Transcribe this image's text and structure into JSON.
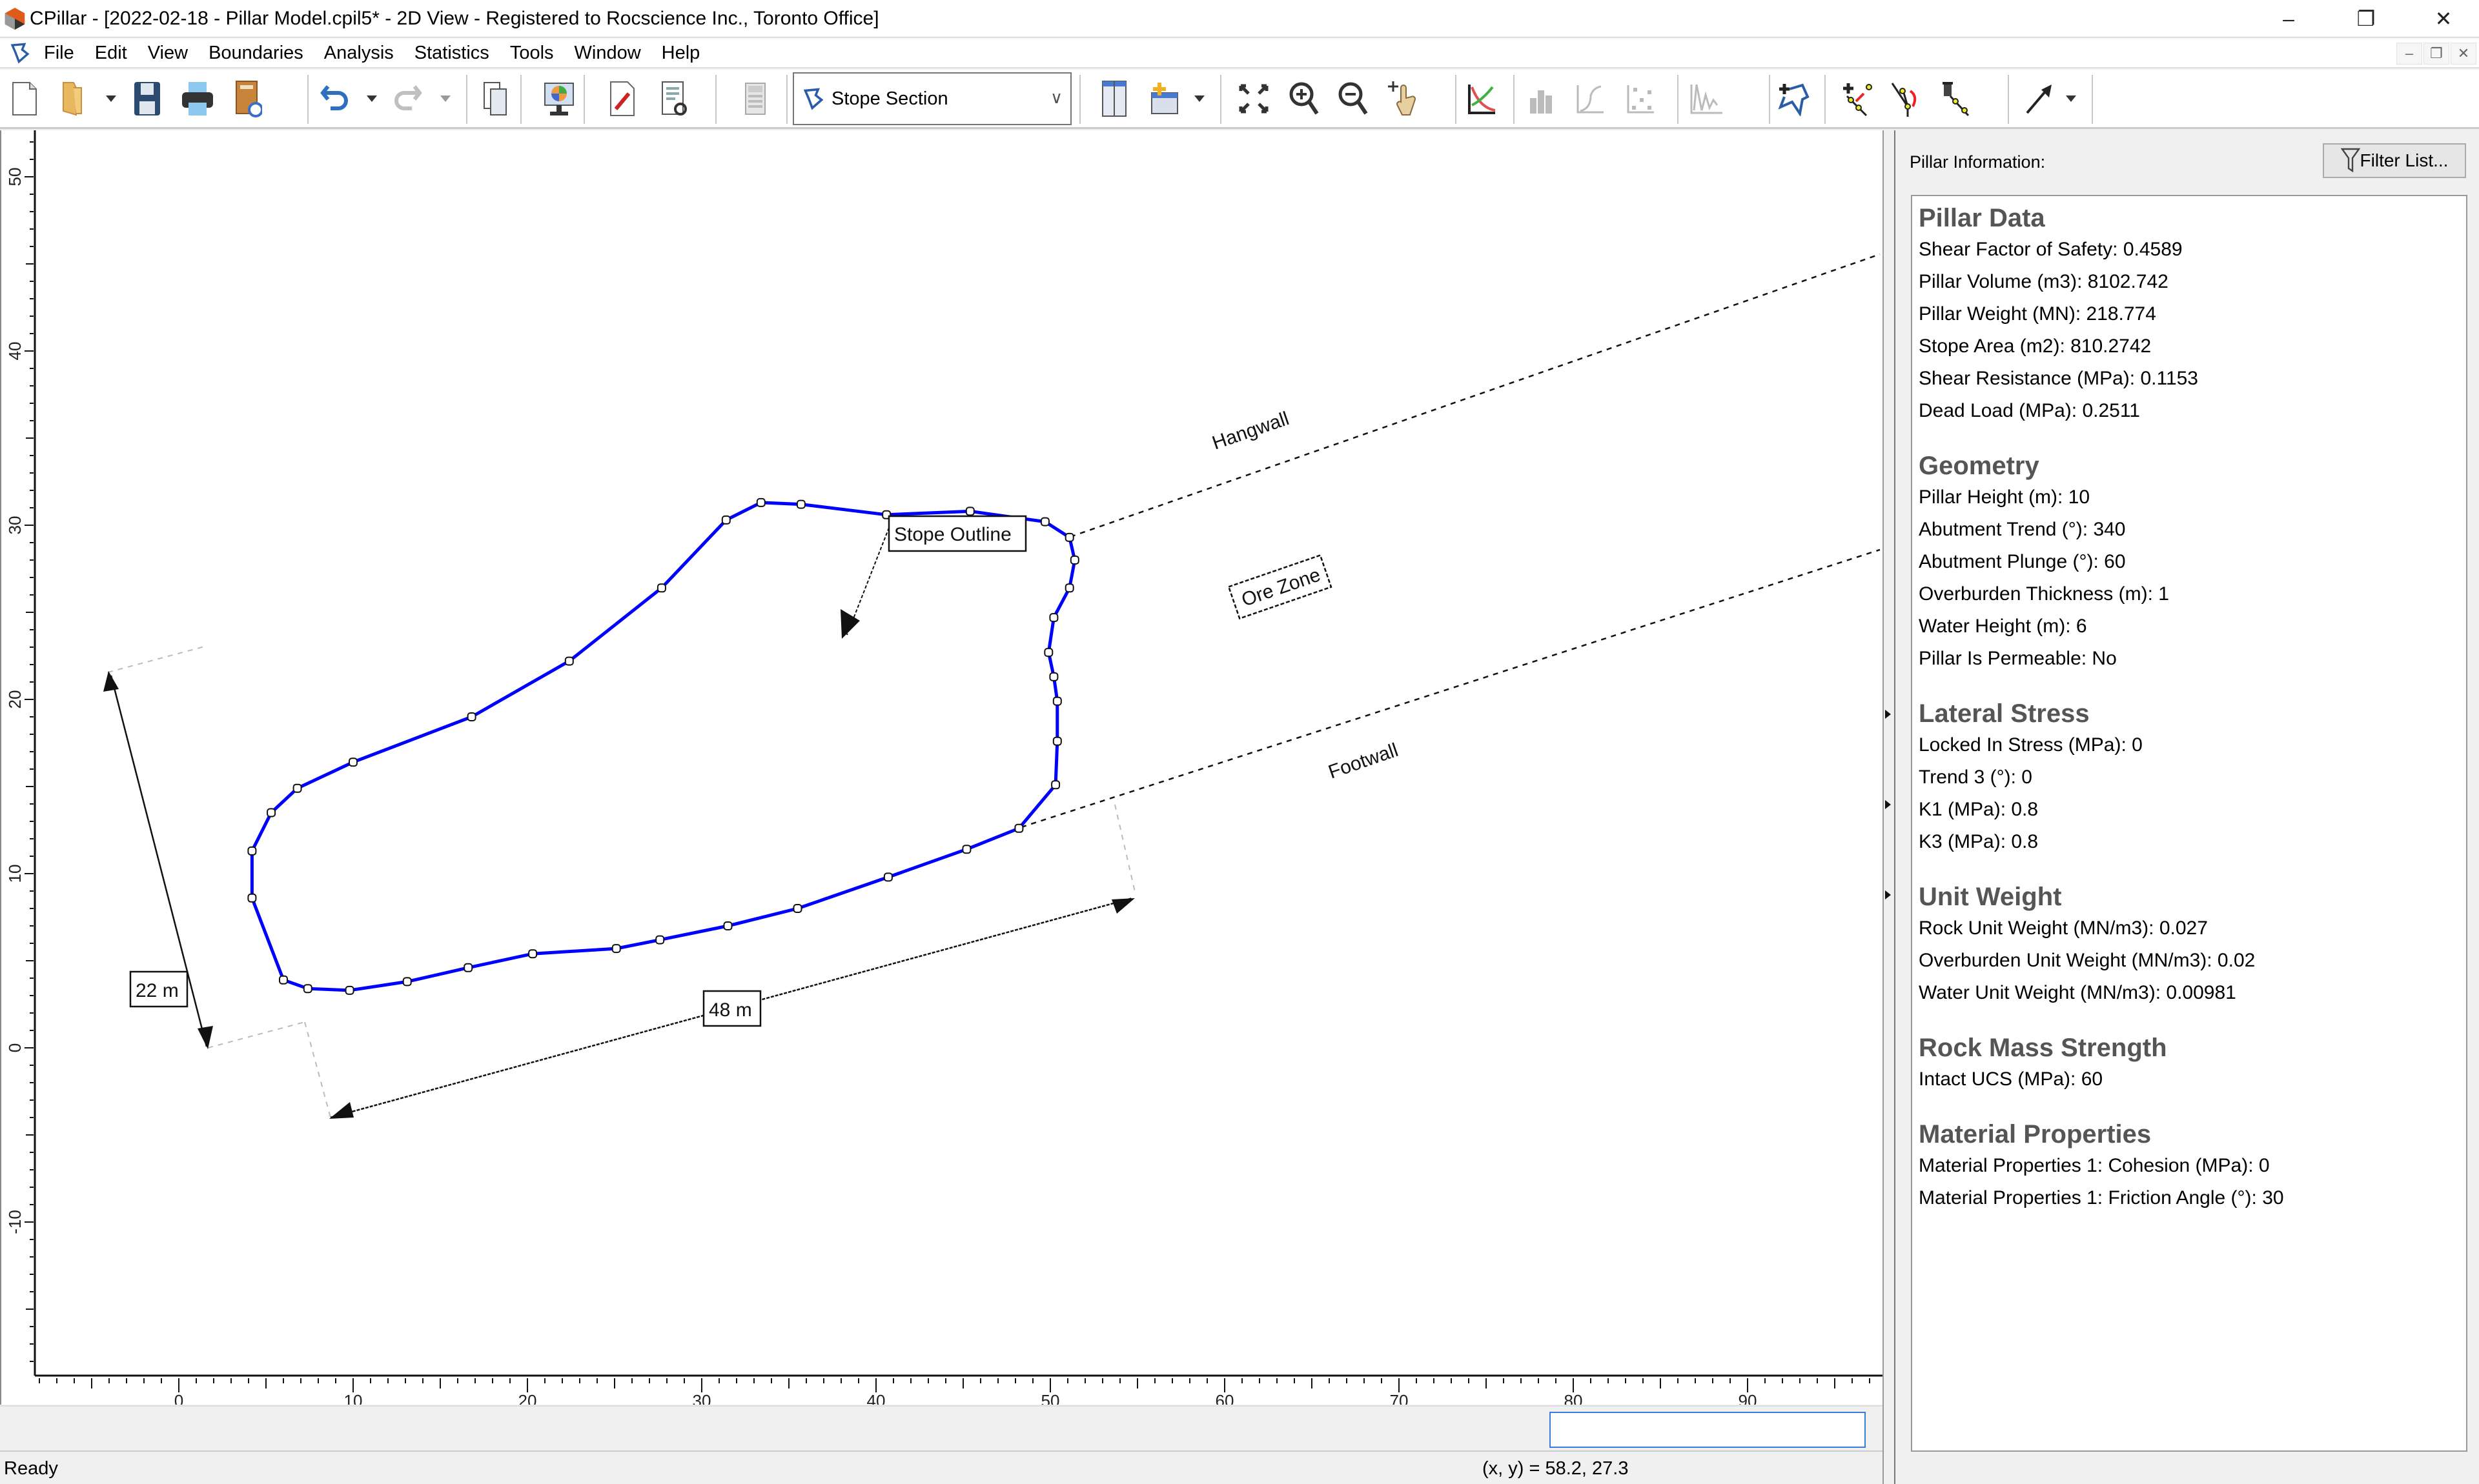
{
  "window": {
    "title": "CPillar - [2022-02-18 - Pillar Model.cpil5* - 2D View - Registered to Rocscience Inc., Toronto Office]",
    "controls": {
      "minimize": "–",
      "restore": "❐",
      "close": "✕"
    },
    "mdi_controls": {
      "minimize": "–",
      "restore": "❐",
      "close": "✕"
    }
  },
  "menu": [
    "File",
    "Edit",
    "View",
    "Boundaries",
    "Analysis",
    "Statistics",
    "Tools",
    "Window",
    "Help"
  ],
  "toolbar": {
    "view_selector": "Stope Section",
    "buttons": [
      "new-file",
      "open-file",
      "save",
      "print",
      "export",
      "undo",
      "redo",
      "copy",
      "display-options",
      "project-settings",
      "analysis-settings",
      "calculator",
      "tile-views",
      "add-view",
      "zoom-all",
      "zoom-in",
      "zoom-out",
      "pan",
      "sensitivity-plot",
      "histogram",
      "cumulative-plot",
      "scatter-plot",
      "convergence-plot",
      "add-stope",
      "add-vertex",
      "move-vertex",
      "delete-vertex",
      "arrow-tool"
    ]
  },
  "canvas": {
    "x_axis_ticks": [
      "0",
      "10",
      "20",
      "30",
      "40",
      "50",
      "60",
      "70",
      "80",
      "90"
    ],
    "y_axis_ticks": [
      "-10",
      "0",
      "10",
      "20",
      "30",
      "40",
      "50"
    ],
    "annotations": {
      "stope_outline": "Stope Outline",
      "hangwall": "Hangwall",
      "ore_zone": "Ore Zone",
      "footwall": "Footwall",
      "dim_height": "22 m",
      "dim_length": "48 m"
    },
    "stope_color": "#0000ff",
    "stope_vertices": [
      [
        33.4,
        31.3
      ],
      [
        35.7,
        31.2
      ],
      [
        40.6,
        30.6
      ],
      [
        45.4,
        30.8
      ],
      [
        49.7,
        30.2
      ],
      [
        51.1,
        29.3
      ],
      [
        51.4,
        28.0
      ],
      [
        51.1,
        26.4
      ],
      [
        50.2,
        24.7
      ],
      [
        49.9,
        22.7
      ],
      [
        50.2,
        21.3
      ],
      [
        50.4,
        19.9
      ],
      [
        50.4,
        17.6
      ],
      [
        50.3,
        15.1
      ],
      [
        48.2,
        12.6
      ],
      [
        45.2,
        11.4
      ],
      [
        40.7,
        9.8
      ],
      [
        35.5,
        8.0
      ],
      [
        31.5,
        7.0
      ],
      [
        27.6,
        6.2
      ],
      [
        25.1,
        5.7
      ],
      [
        20.3,
        5.4
      ],
      [
        16.6,
        4.6
      ],
      [
        13.1,
        3.8
      ],
      [
        9.8,
        3.3
      ],
      [
        7.4,
        3.4
      ],
      [
        6.0,
        3.9
      ],
      [
        4.2,
        8.6
      ],
      [
        4.2,
        11.3
      ],
      [
        5.3,
        13.5
      ],
      [
        6.8,
        14.9
      ],
      [
        10.0,
        16.4
      ],
      [
        16.8,
        19.0
      ],
      [
        22.4,
        22.2
      ],
      [
        27.7,
        26.4
      ],
      [
        31.4,
        30.3
      ]
    ]
  },
  "status": {
    "ready": "Ready",
    "coords": "(x, y) = 58.2, 27.3"
  },
  "panel": {
    "label": "Pillar Information:",
    "filter_button": "Filter List...",
    "sections": [
      {
        "title": "Pillar Data",
        "rows": [
          "Shear Factor of Safety: 0.4589",
          "Pillar Volume (m3): 8102.742",
          "Pillar Weight (MN): 218.774",
          "Stope Area (m2): 810.2742",
          "Shear Resistance (MPa): 0.1153",
          "Dead Load (MPa): 0.2511"
        ]
      },
      {
        "title": "Geometry",
        "rows": [
          "Pillar Height (m): 10",
          "Abutment Trend (°): 340",
          "Abutment Plunge (°): 60",
          "Overburden Thickness (m): 1",
          "Water Height (m): 6",
          "Pillar Is Permeable: No"
        ]
      },
      {
        "title": "Lateral Stress",
        "rows": [
          "Locked In Stress (MPa): 0",
          "Trend 3 (°): 0",
          "K1 (MPa): 0.8",
          "K3 (MPa): 0.8"
        ]
      },
      {
        "title": "Unit Weight",
        "rows": [
          "Rock Unit Weight (MN/m3): 0.027",
          "Overburden Unit Weight (MN/m3): 0.02",
          "Water Unit Weight (MN/m3): 0.00981"
        ]
      },
      {
        "title": "Rock Mass Strength",
        "rows": [
          "Intact UCS (MPa): 60"
        ]
      },
      {
        "title": "Material Properties",
        "rows": [
          "Material Properties 1: Cohesion (MPa): 0",
          "Material Properties 1: Friction Angle (°): 30"
        ]
      }
    ]
  }
}
